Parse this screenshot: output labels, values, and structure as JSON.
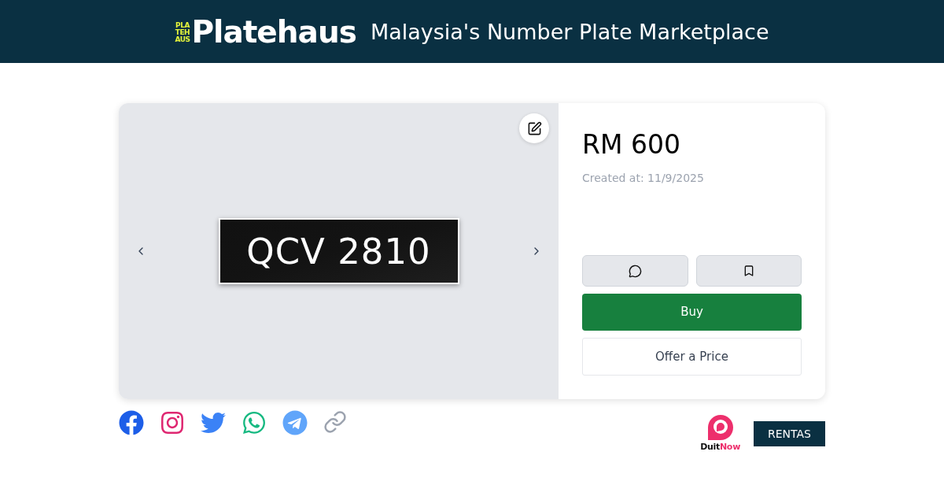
{
  "header": {
    "logo_badge_lines": [
      "PLA",
      "TEH",
      "AUS"
    ],
    "logo_text": "Platehaus",
    "tagline": "Malaysia's Number Plate Marketplace"
  },
  "listing": {
    "plate": "QCV 2810",
    "price": "RM 600",
    "created": "Created at: 11/9/2025",
    "buy_button": "Buy",
    "offer_button": "Offer a Price"
  },
  "payment": {
    "wordmark_parts": [
      "Duit",
      "Now"
    ],
    "rentas": "RENTAS"
  }
}
